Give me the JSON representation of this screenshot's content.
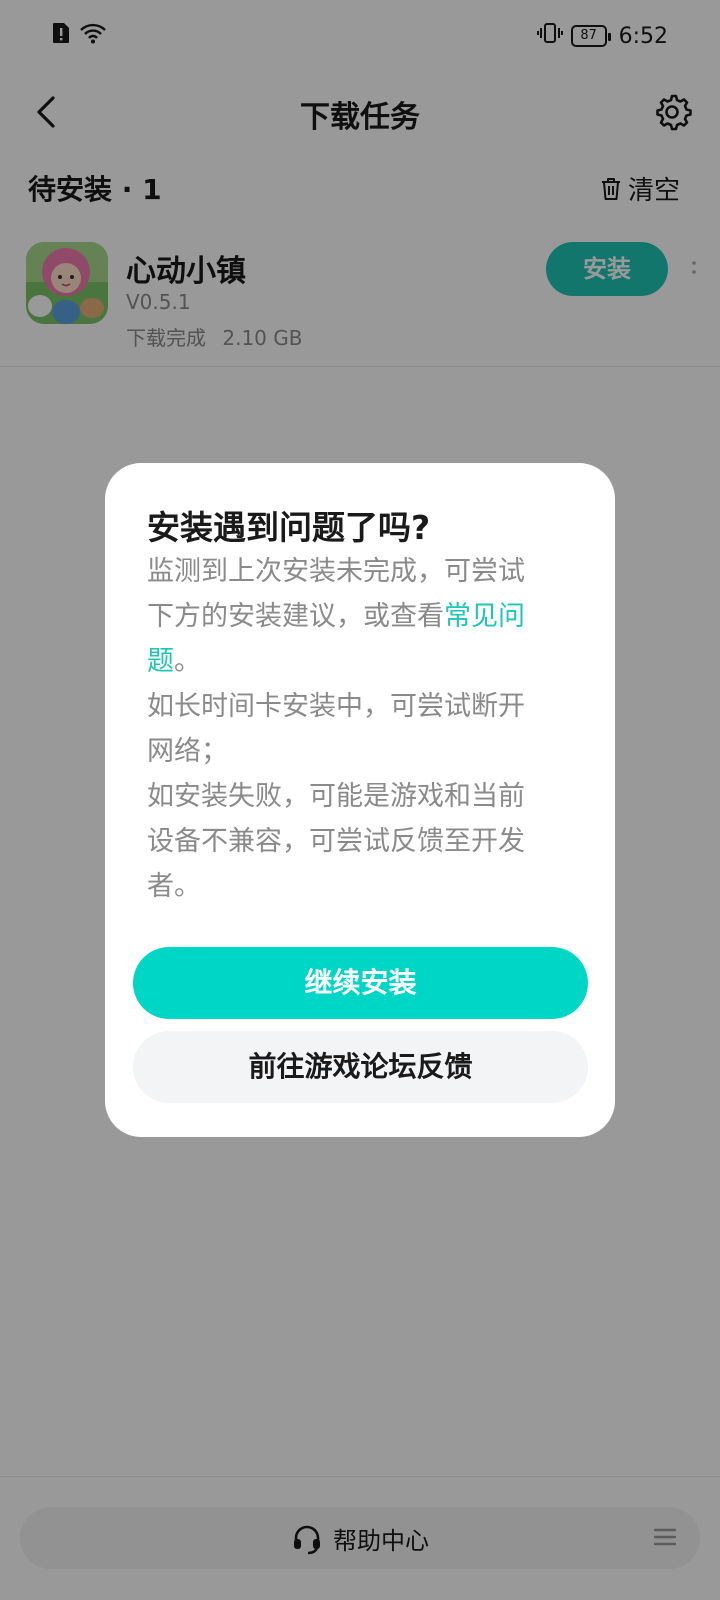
{
  "status_bar": {
    "time": "6:52",
    "battery": "87",
    "icons": [
      "sim-alert-icon",
      "wifi-icon",
      "vibrate-icon",
      "battery-icon"
    ]
  },
  "header": {
    "title": "下载任务",
    "back_icon": "chevron-left-icon",
    "settings_icon": "gear-icon"
  },
  "section": {
    "title": "待安装 · 1",
    "clear_label": "清空",
    "clear_icon": "trash-icon"
  },
  "item": {
    "name": "心动小镇",
    "version": "V0.5.1",
    "status": "下载完成",
    "size": "2.10 GB",
    "install_label": "安装"
  },
  "dialog": {
    "title": "安装遇到问题了吗?",
    "p1_text": "监测到上次安装未完成，可尝试下方的安装建议，或查看",
    "p1_link": "常见问题",
    "p1_end": "。",
    "p2": "如长时间卡安装中，可尝试断开网络；",
    "p3": "如安装失败，可能是游戏和当前设备不兼容，可尝试反馈至开发者。",
    "primary_label": "继续安装",
    "secondary_label": "前往游戏论坛反馈"
  },
  "bottom": {
    "help_label": "帮助中心",
    "help_icon": "headset-icon",
    "menu_icon": "menu-icon"
  },
  "colors": {
    "accent": "#00d6c6",
    "install_button": "#1fc5b5",
    "overlay": "rgba(0,0,0,0.40)"
  }
}
